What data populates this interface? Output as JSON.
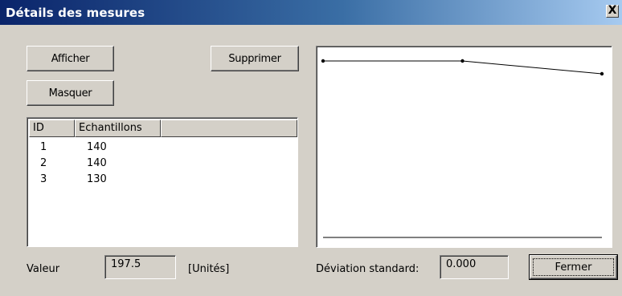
{
  "window": {
    "title": "Détails des mesures",
    "close_label": "X"
  },
  "buttons": {
    "afficher": "Afficher",
    "masquer": "Masquer",
    "supprimer": "Supprimer",
    "fermer": "Fermer"
  },
  "table": {
    "columns": [
      "ID",
      "Echantillons",
      ""
    ],
    "rows": [
      {
        "id": "1",
        "echantillons": "140"
      },
      {
        "id": "2",
        "echantillons": "140"
      },
      {
        "id": "3",
        "echantillons": "130"
      }
    ]
  },
  "footer": {
    "valeur_label": "Valeur",
    "valeur_value": "197.5",
    "unit_label": "[Unités]",
    "deviation_label": "Déviation standard:",
    "deviation_value": "0.000"
  },
  "chart_data": {
    "type": "line",
    "x": [
      1,
      2,
      3
    ],
    "series": [
      {
        "values": [
          140,
          140,
          130
        ]
      }
    ],
    "title": "",
    "xlabel": "",
    "ylabel": "",
    "grid": false
  }
}
